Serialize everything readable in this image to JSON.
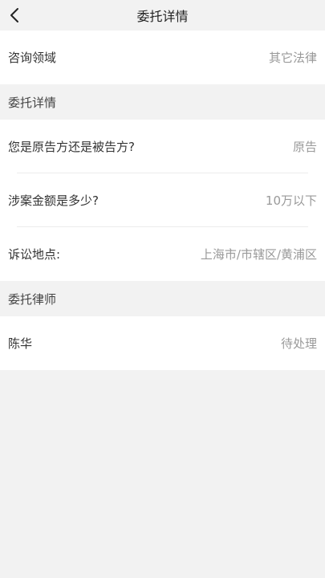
{
  "header": {
    "title": "委托详情",
    "back_icon": "chevron-left-icon"
  },
  "consult": {
    "label": "咨询领域",
    "value": "其它法律"
  },
  "details": {
    "section_title": "委托详情",
    "rows": [
      {
        "label": "您是原告方还是被告方?",
        "value": "原告"
      },
      {
        "label": "涉案金额是多少?",
        "value": "10万以下"
      },
      {
        "label": "诉讼地点:",
        "value": "上海市/市辖区/黄浦区"
      }
    ]
  },
  "lawyer": {
    "section_title": "委托律师",
    "name": "陈华",
    "status": "待处理"
  }
}
